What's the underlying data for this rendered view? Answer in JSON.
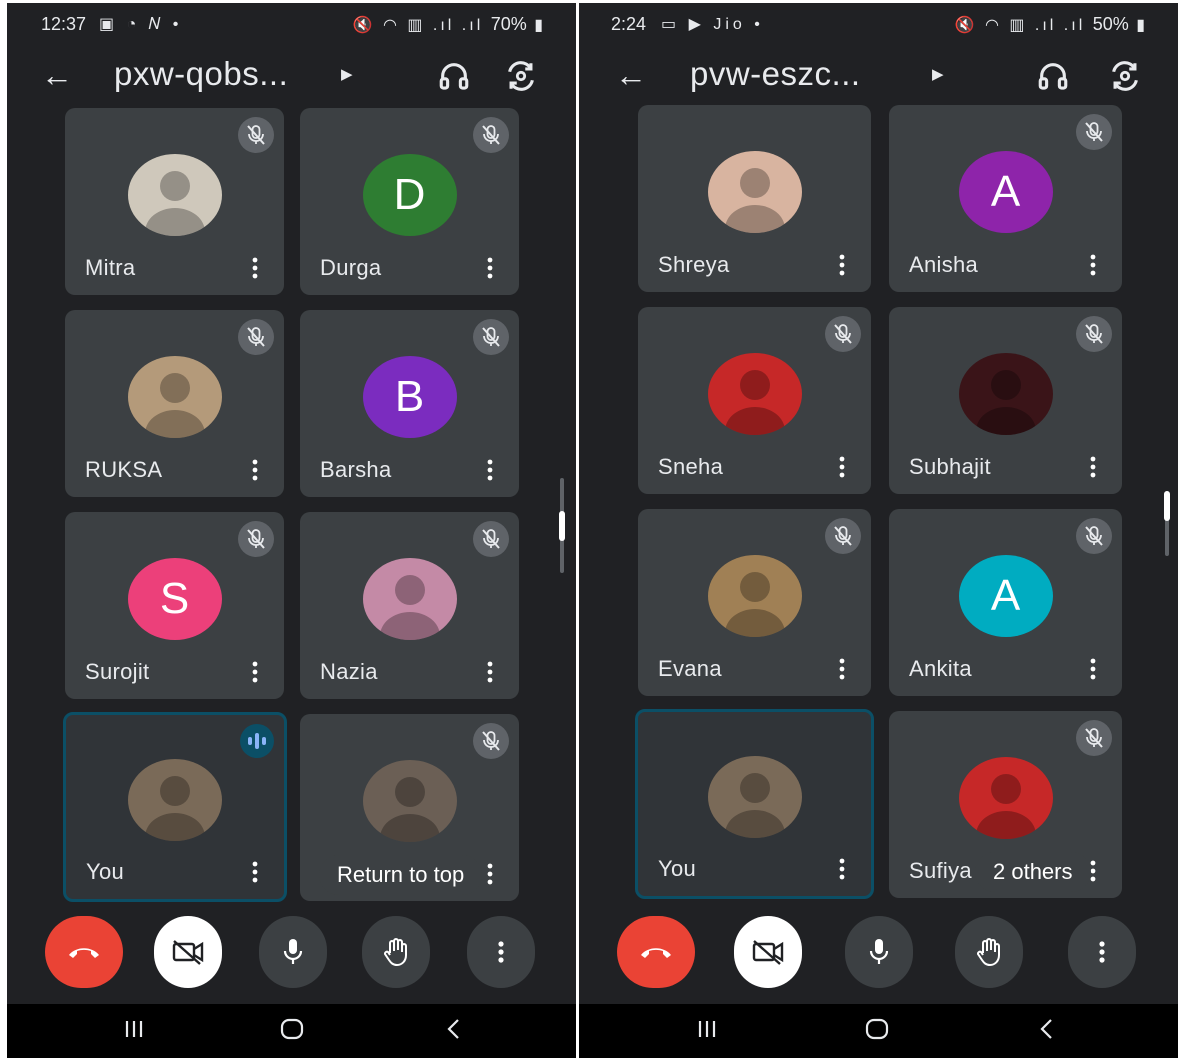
{
  "phones": [
    {
      "status": {
        "time": "12:37",
        "left_icons": "▣ ◔ 𝑁 •",
        "right_icons": "🔇 ◠ ▥ .ıl .ıl",
        "battery": "70%"
      },
      "title": "pxw-qobs...",
      "tiles": [
        {
          "name": "Mitra",
          "avatar": {
            "type": "photo",
            "color": "#cfc8bb"
          },
          "mic": "off"
        },
        {
          "name": "Durga",
          "avatar": {
            "type": "letter",
            "letter": "D",
            "color": "#2e7d32"
          },
          "mic": "off"
        },
        {
          "name": "RUKSA",
          "avatar": {
            "type": "photo",
            "color": "#b49a7a"
          },
          "mic": "off"
        },
        {
          "name": "Barsha",
          "avatar": {
            "type": "letter",
            "letter": "B",
            "color": "#7b2cbf"
          },
          "mic": "off"
        },
        {
          "name": "Surojit",
          "avatar": {
            "type": "letter",
            "letter": "S",
            "color": "#ec407a"
          },
          "mic": "off"
        },
        {
          "name": "Nazia",
          "avatar": {
            "type": "photo",
            "color": "#c48aa6"
          },
          "mic": "off"
        },
        {
          "name": "You",
          "avatar": {
            "type": "photo",
            "color": "#7a6a58"
          },
          "mic": "speaking",
          "self": true
        },
        {
          "name": "",
          "avatar": {
            "type": "photo",
            "color": "#6b5f55"
          },
          "mic": "off"
        }
      ],
      "pill_label": "Return to top"
    },
    {
      "status": {
        "time": "2:24",
        "left_icons": "▭ ▶ Jio •",
        "right_icons": "🔇 ◠ ▥ .ıl .ıl",
        "battery": "50%"
      },
      "title": "pvw-eszc...",
      "tiles": [
        {
          "name": "Shreya",
          "avatar": {
            "type": "photo",
            "color": "#d8b4a0"
          },
          "mic": "on"
        },
        {
          "name": "Anisha",
          "avatar": {
            "type": "letter",
            "letter": "A",
            "color": "#8e24aa"
          },
          "mic": "off"
        },
        {
          "name": "Sneha",
          "avatar": {
            "type": "photo",
            "color": "#c62828"
          },
          "mic": "off"
        },
        {
          "name": "Subhajit",
          "avatar": {
            "type": "photo",
            "color": "#3a1418"
          },
          "mic": "off"
        },
        {
          "name": "Evana",
          "avatar": {
            "type": "photo",
            "color": "#a08055"
          },
          "mic": "off"
        },
        {
          "name": "Ankita",
          "avatar": {
            "type": "letter",
            "letter": "A",
            "color": "#00acc1"
          },
          "mic": "off"
        },
        {
          "name": "You",
          "avatar": {
            "type": "photo",
            "color": "#7a6a58"
          },
          "mic": "none",
          "self": true
        },
        {
          "name": "Sufiya",
          "avatar": {
            "type": "photo",
            "color": "#c62828"
          },
          "mic": "off"
        }
      ],
      "pill_label": "2 others"
    }
  ],
  "icons": {
    "back": "arrow-left-icon",
    "audio": "headphones-icon",
    "switch_camera": "camera-switch-icon",
    "mic_off": "mic-off-icon",
    "more": "more-vert-icon",
    "end_call": "call-end-icon",
    "camera_off": "videocam-off-icon",
    "mic": "mic-icon",
    "raise_hand": "hand-icon",
    "nav_recents": "recents-icon",
    "nav_home": "home-icon",
    "nav_back": "nav-back-icon"
  },
  "colors": {
    "call_background": "#202124",
    "tile": "#3c4043",
    "end_call": "#ea4335",
    "self_border": "#0b4f66"
  }
}
